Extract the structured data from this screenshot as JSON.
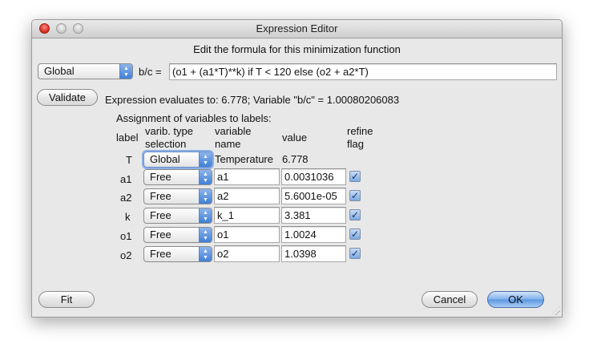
{
  "window": {
    "title": "Expression Editor"
  },
  "heading": "Edit the formula for this minimization function",
  "expression": {
    "scope_select": "Global",
    "depvar_label": "b/c =",
    "formula": "(o1 + (a1*T)**k) if T < 120 else (o2 + a2*T)"
  },
  "validate_button": "Validate",
  "status_text": "Expression evaluates to: 6.778; Variable \"b/c\" = 1.00080206083",
  "assignment_title": "Assignment of variables to labels:",
  "columns": {
    "label": "label",
    "varib_type_1": "varib. type",
    "varib_type_2": "selection",
    "varname_1": "variable",
    "varname_2": "name",
    "value": "value",
    "refine_1": "refine",
    "refine_2": "flag"
  },
  "rows": [
    {
      "label": "T",
      "type": "Global",
      "name": "Temperature",
      "value": "6.778",
      "refine": false
    },
    {
      "label": "a1",
      "type": "Free",
      "name": "a1",
      "value": "0.0031036",
      "refine": true
    },
    {
      "label": "a2",
      "type": "Free",
      "name": "a2",
      "value": "5.6001e-05",
      "refine": true
    },
    {
      "label": "k",
      "type": "Free",
      "name": "k_1",
      "value": "3.381",
      "refine": true
    },
    {
      "label": "o1",
      "type": "Free",
      "name": "o1",
      "value": "1.0024",
      "refine": true
    },
    {
      "label": "o2",
      "type": "Free",
      "name": "o2",
      "value": "1.0398",
      "refine": true
    }
  ],
  "buttons": {
    "fit": "Fit",
    "cancel": "Cancel",
    "ok": "OK"
  },
  "icons": {
    "checkbox": "check-mark",
    "popup_arrows": "up-down-arrows"
  },
  "colors": {
    "accent": "#5b95e0",
    "window_bg": "#e8e8e8"
  }
}
